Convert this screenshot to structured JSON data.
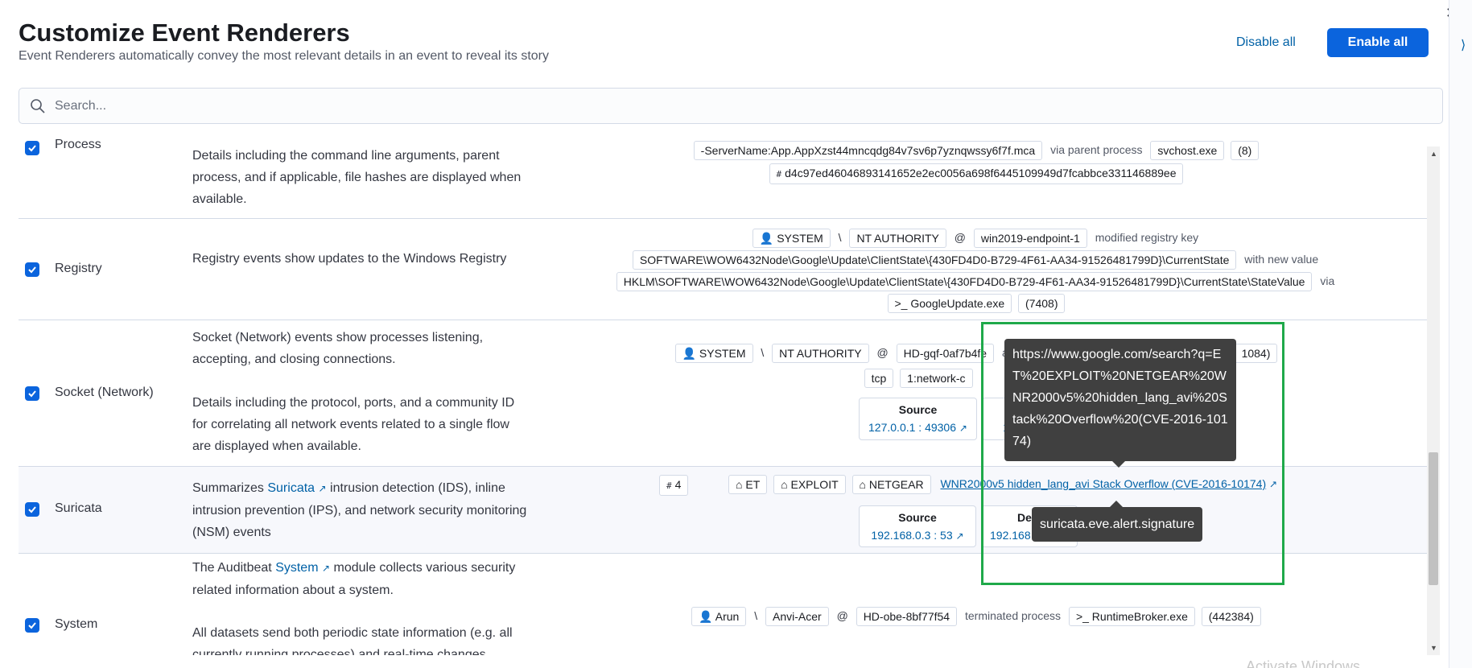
{
  "header": {
    "title": "Customize Event Renderers",
    "subtitle": "Event Renderers automatically convey the most relevant details in an event to reveal its story",
    "disable_all": "Disable all",
    "enable_all": "Enable all"
  },
  "search": {
    "placeholder": "Search..."
  },
  "rows": {
    "process": {
      "name": "Process",
      "description": "Details including the command line arguments, parent process, and if applicable, file hashes are displayed when available.",
      "line1": {
        "arg": "-ServerName:App.AppXzst44mncqdg84v7sv6p7yznqwssy6f7f.mca",
        "via": "via parent process",
        "parent": "svchost.exe",
        "pid": "(8)"
      },
      "hash": "d4c97ed46046893141652e2ec0056a698f6445109949d7fcabbce331146889ee"
    },
    "registry": {
      "name": "Registry",
      "description": "Registry events show updates to the Windows Registry",
      "user": "SYSTEM",
      "domain": "NT AUTHORITY",
      "host": "win2019-endpoint-1",
      "action": "modified registry key",
      "key": "SOFTWARE\\WOW6432Node\\Google\\Update\\ClientState\\{430FD4D0-B729-4F61-AA34-91526481799D}\\CurrentState",
      "with_new_value": "with new value",
      "value": "HKLM\\SOFTWARE\\WOW6432Node\\Google\\Update\\ClientState\\{430FD4D0-B729-4F61-AA34-91526481799D}\\CurrentState\\StateValue",
      "via": "via",
      "process": "GoogleUpdate.exe",
      "pid": "(7408)"
    },
    "socket": {
      "name": "Socket (Network)",
      "description1": "Socket (Network) events show processes listening, accepting, and closing connections.",
      "description2": "Details including the protocol, ports, and a community ID for correlating all network events related to a single flow are displayed when available.",
      "user": "SYSTEM",
      "domain": "NT AUTHORITY",
      "host": "HD-gqf-0af7b4fe",
      "action_partial": "ac",
      "pid_partial": "1084)",
      "proto": "tcp",
      "community_partial": "1:network-c",
      "source_label": "Source",
      "source_value": "127.0.0.1 : 49306",
      "dest_partial": "1"
    },
    "suricata": {
      "name": "Suricata",
      "desc_pre": "Summarizes ",
      "desc_link": "Suricata",
      "desc_post": " intrusion detection (IDS), inline intrusion prevention (IPS), and network security monitoring (NSM) events",
      "count": "4",
      "tags": [
        "ET",
        "EXPLOIT",
        "NETGEAR"
      ],
      "signature": "WNR2000v5 hidden_lang_avi Stack Overflow (CVE-2016-10174)",
      "source_label": "Source",
      "source_value": "192.168.0.3 : 53",
      "dest_label_partial": "De",
      "dest_value_partial": "192.168"
    },
    "system": {
      "name": "System",
      "desc_pre": "The Auditbeat ",
      "desc_link": "System",
      "desc_post": " module collects various security related information about a system.",
      "desc2": "All datasets send both periodic state information (e.g. all currently running processes) and real-time changes",
      "user": "Arun",
      "domain": "Anvi-Acer",
      "host": "HD-obe-8bf77f54",
      "action": "terminated process",
      "process": "RuntimeBroker.exe",
      "pid": "(442384)"
    }
  },
  "tooltips": {
    "url": "https://www.google.com/search?q=ET%20EXPLOIT%20NETGEAR%20WNR2000v5%20hidden_lang_avi%20Stack%20Overflow%20(CVE-2016-10174)",
    "field": "suricata.eve.alert.signature"
  },
  "watermark": "Activate Windows",
  "colors": {
    "accent": "#0b64dd",
    "link": "#0061a6",
    "highlight": "#1fa94a",
    "tooltip_bg": "#404040"
  }
}
